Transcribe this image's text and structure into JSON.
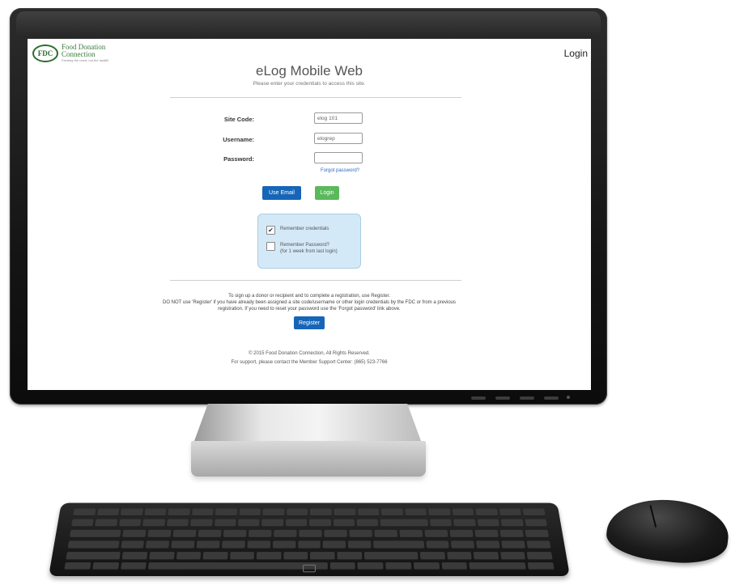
{
  "app": {
    "logo_badge": "FDC",
    "logo_line1": "Food Donation",
    "logo_line2": "Connection",
    "logo_tagline": "Feeding the need, not the landfill",
    "top_login": "Login"
  },
  "login": {
    "title": "eLog Mobile Web",
    "subtitle": "Please enter your credentials to access this site.",
    "site_code_label": "Site Code:",
    "site_code_value": "elog 101",
    "username_label": "Username:",
    "username_value": "elogrep",
    "password_label": "Password:",
    "password_value": "",
    "forgot_link": "Forgot password?",
    "use_email_button": "Use Email",
    "login_button": "Login",
    "remember_site_label": "Remember credentials",
    "remember_site_checked": true,
    "remember_password_label": "Remember Password?",
    "remember_password_sub": "(for 1 week from last login)",
    "remember_password_checked": false
  },
  "register": {
    "line1": "To sign up a donor or recipient and to complete a registration, use Register.",
    "line2": "DO NOT use 'Register' if you have already been assigned a site code/username or other login credentials by the FDC or from a previous",
    "line3": "registration. If you need to reset your password use the 'Forgot password' link above.",
    "button": "Register"
  },
  "footer": {
    "copyright": "© 2015 Food Donation Connection, All Rights Reserved.",
    "support": "For support, please contact the Member Support Center: (865) 523-7766"
  }
}
